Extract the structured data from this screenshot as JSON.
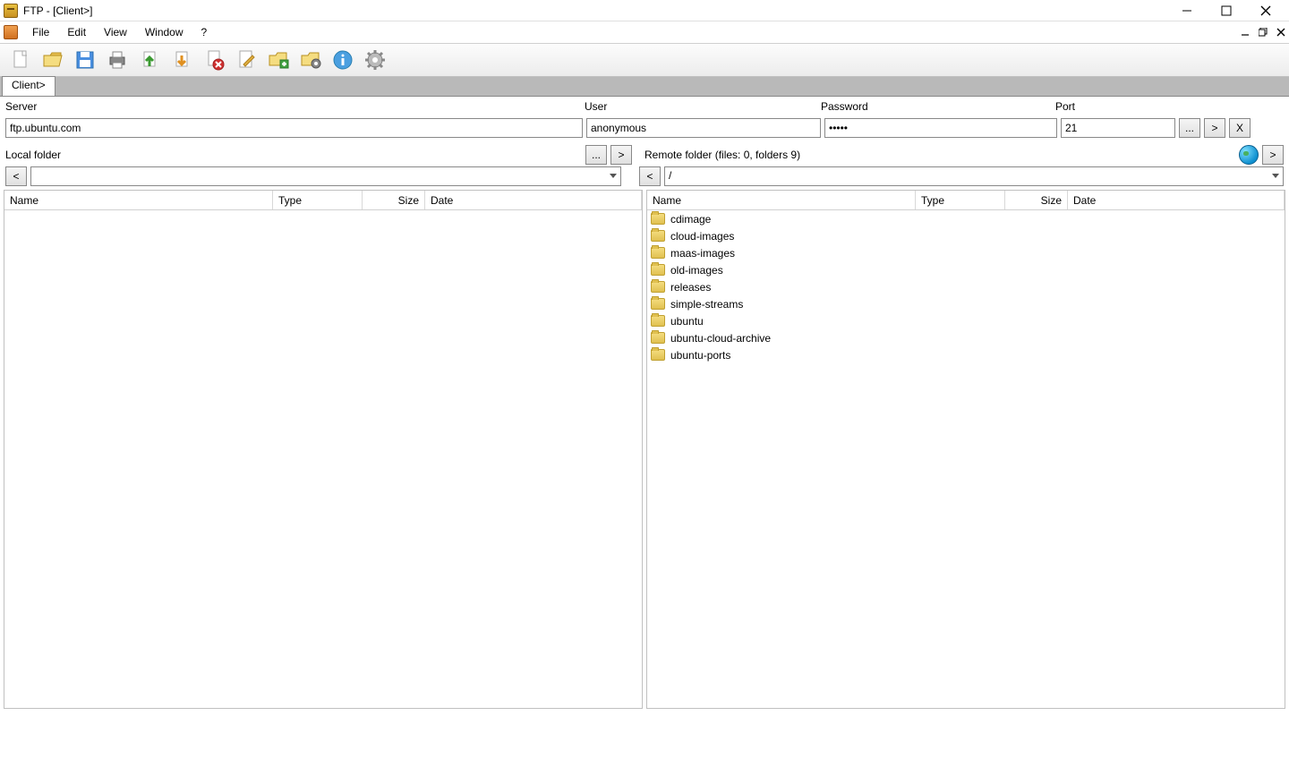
{
  "window": {
    "title": "FTP - [Client>]"
  },
  "menu": {
    "items": [
      "File",
      "Edit",
      "View",
      "Window",
      "?"
    ]
  },
  "tabs": {
    "active": "Client>"
  },
  "connection": {
    "labels": {
      "server": "Server",
      "user": "User",
      "password": "Password",
      "port": "Port"
    },
    "server": "ftp.ubuntu.com",
    "user": "anonymous",
    "password": "•••••",
    "port": "21",
    "browse_btn": "...",
    "go_btn": ">",
    "close_btn": "X"
  },
  "folders_bar": {
    "local_label": "Local folder",
    "local_browse": "...",
    "local_go": ">",
    "remote_label": "Remote folder (files: 0, folders 9)",
    "remote_go": ">"
  },
  "nav": {
    "local_back": "<",
    "local_path": "",
    "remote_back": "<",
    "remote_path": "/"
  },
  "columns": {
    "name": "Name",
    "type": "Type",
    "size": "Size",
    "date": "Date"
  },
  "remote_list": [
    {
      "name": "cdimage"
    },
    {
      "name": "cloud-images"
    },
    {
      "name": "maas-images"
    },
    {
      "name": "old-images"
    },
    {
      "name": "releases"
    },
    {
      "name": "simple-streams"
    },
    {
      "name": "ubuntu"
    },
    {
      "name": "ubuntu-cloud-archive"
    },
    {
      "name": "ubuntu-ports"
    }
  ],
  "toolbar_icons": [
    "new-doc-icon",
    "open-folder-icon",
    "save-icon",
    "print-icon",
    "upload-icon",
    "download-icon",
    "delete-icon",
    "edit-icon",
    "new-folder-icon",
    "settings-folder-icon",
    "info-icon",
    "gear-icon"
  ]
}
